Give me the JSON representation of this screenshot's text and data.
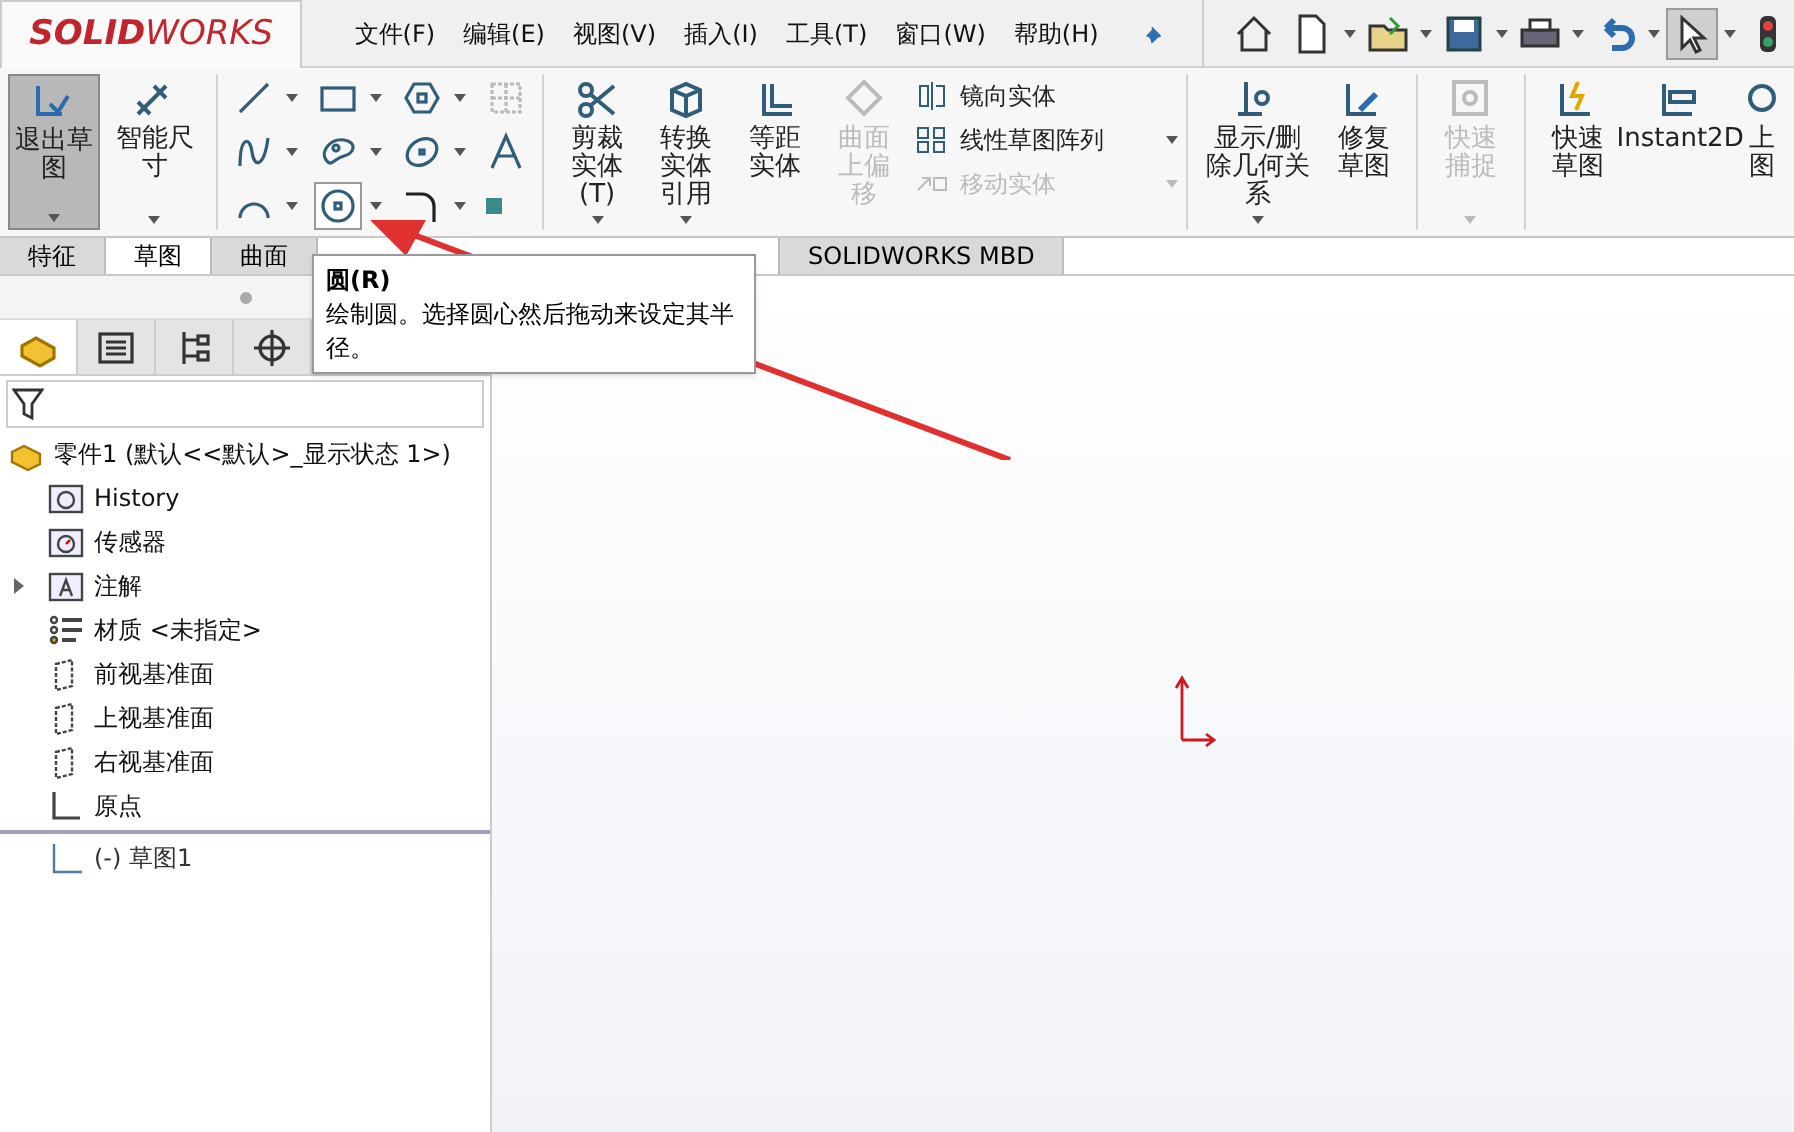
{
  "logo": "**SOLID**WORKS",
  "menu": [
    {
      "label": "文件(F)"
    },
    {
      "label": "编辑(E)"
    },
    {
      "label": "视图(V)"
    },
    {
      "label": "插入(I)"
    },
    {
      "label": "工具(T)"
    },
    {
      "label": "窗口(W)"
    },
    {
      "label": "帮助(H)"
    }
  ],
  "quick_access": [
    {
      "kind": "home",
      "selected": false
    },
    {
      "kind": "new",
      "selected": false
    },
    {
      "kind": "open",
      "selected": false
    },
    {
      "kind": "save",
      "selected": false
    },
    {
      "kind": "print",
      "selected": false
    },
    {
      "kind": "undo",
      "selected": false
    },
    {
      "kind": "select",
      "selected": true
    },
    {
      "kind": "rebuild",
      "selected": false
    }
  ],
  "ribbon_left": [
    {
      "kind": "exit-sketch",
      "label": "退出草图",
      "selected": true
    },
    {
      "kind": "smart-dimension",
      "label": "智能尺寸",
      "selected": false
    }
  ],
  "sketch_tools": [
    {
      "kind": "line",
      "selected": false,
      "disabled": false
    },
    {
      "kind": "rectangle",
      "selected": false,
      "disabled": false
    },
    {
      "kind": "polygon",
      "selected": false,
      "disabled": false
    },
    {
      "kind": "grid",
      "selected": false,
      "disabled": true
    },
    {
      "kind": "spline",
      "selected": false,
      "disabled": false
    },
    {
      "kind": "slot",
      "selected": false,
      "disabled": false
    },
    {
      "kind": "ellipse",
      "selected": false,
      "disabled": false
    },
    {
      "kind": "text",
      "selected": false,
      "disabled": false
    },
    {
      "kind": "arc",
      "selected": false,
      "disabled": false
    },
    {
      "kind": "circle",
      "selected": true,
      "disabled": false
    },
    {
      "kind": "fillet",
      "selected": false,
      "disabled": false
    },
    {
      "kind": "point",
      "selected": false,
      "disabled": false
    }
  ],
  "ribbon_mid": [
    {
      "kind": "trim",
      "label": "剪裁实体(T)",
      "disabled": false
    },
    {
      "kind": "convert",
      "label": "转换实体引用",
      "disabled": false
    },
    {
      "kind": "offset",
      "label": "等距实体",
      "disabled": false
    },
    {
      "kind": "surface-offset",
      "label": "曲面上偏移",
      "disabled": true
    }
  ],
  "ribbon_list": [
    {
      "kind": "mirror",
      "label": "镜向实体",
      "disabled": false
    },
    {
      "kind": "pattern",
      "label": "线性草图阵列",
      "disabled": false
    },
    {
      "kind": "move",
      "label": "移动实体",
      "disabled": true
    }
  ],
  "ribbon_right": [
    {
      "kind": "relations",
      "label": "显示/删除几何关系",
      "disabled": false
    },
    {
      "kind": "repair",
      "label": "修复草图",
      "disabled": false
    },
    {
      "kind": "snap",
      "label": "快速捕捉",
      "disabled": true
    },
    {
      "kind": "rapid-sketch",
      "label": "快速草图",
      "disabled": false
    },
    {
      "kind": "instant2d",
      "label": "Instant2D",
      "disabled": false
    },
    {
      "kind": "shaded",
      "label": "上图",
      "disabled": false
    }
  ],
  "tabs": [
    {
      "label": "特征",
      "selected": false
    },
    {
      "label": "草图",
      "selected": true
    },
    {
      "label": "曲面",
      "selected": false
    },
    {
      "label": "SOLIDWORKS MBD",
      "selected": false
    }
  ],
  "tooltip": {
    "title": "圆(R)",
    "body": "绘制圆。选择圆心然后拖动来设定其半径。"
  },
  "panel_tabs": [
    {
      "kind": "feature-tree",
      "selected": true
    },
    {
      "kind": "property",
      "selected": false
    },
    {
      "kind": "config",
      "selected": false
    },
    {
      "kind": "dimxpert",
      "selected": false
    }
  ],
  "tree": {
    "kind": "part",
    "label": "零件1  (默认<<默认>_显示状态 1>)",
    "children": [
      {
        "kind": "history",
        "label": "History"
      },
      {
        "kind": "sensor",
        "label": "传感器"
      },
      {
        "kind": "annotation",
        "label": "注解",
        "expanded": false
      },
      {
        "kind": "material",
        "label": "材质 <未指定>"
      },
      {
        "kind": "plane",
        "label": "前视基准面"
      },
      {
        "kind": "plane",
        "label": "上视基准面"
      },
      {
        "kind": "plane",
        "label": "右视基准面"
      },
      {
        "kind": "origin",
        "label": "原点"
      },
      {
        "kind": "sketch",
        "label": "(-) 草图1",
        "rolled": true
      }
    ]
  }
}
